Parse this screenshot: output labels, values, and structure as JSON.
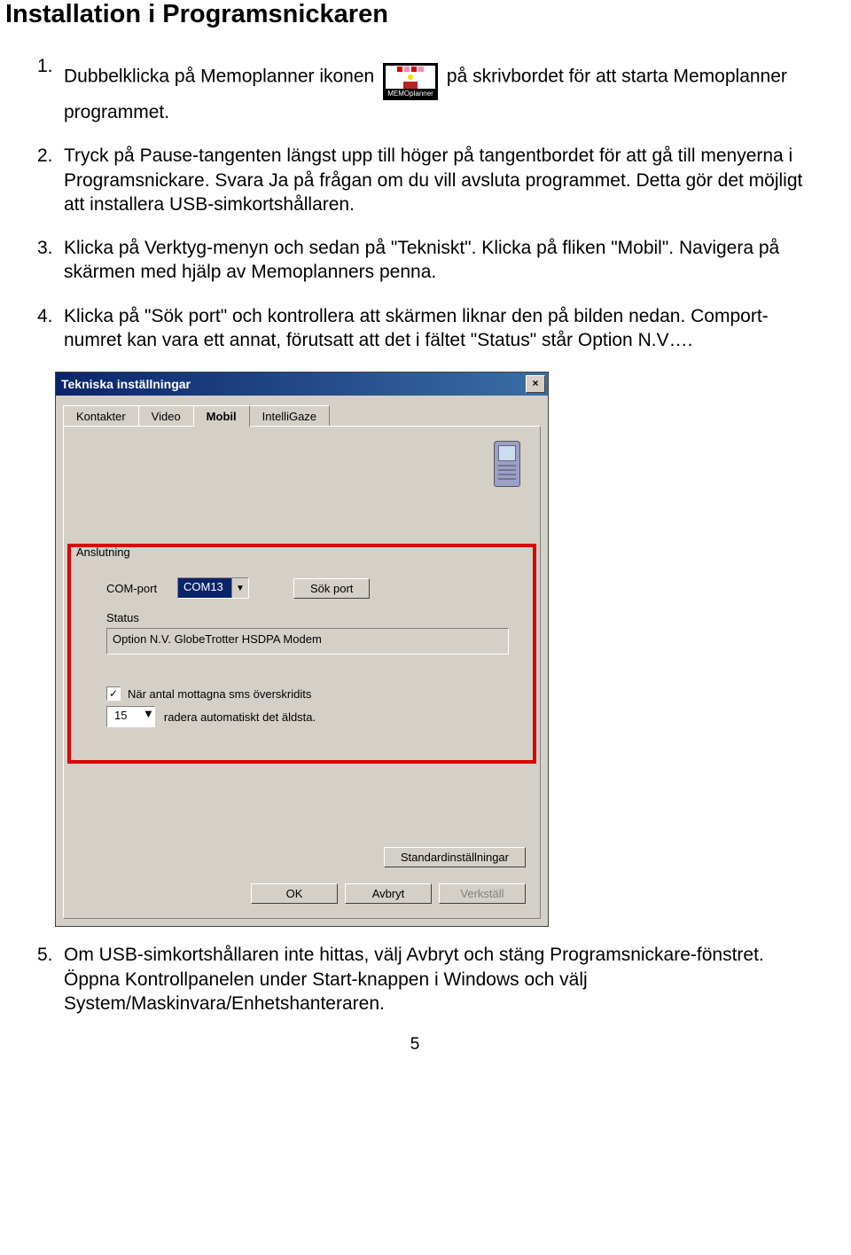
{
  "title": "Installation i Programsnickaren",
  "items": {
    "i1": {
      "num": "1.",
      "t1": "Dubbelklicka på Memoplanner ikonen",
      "t2": "på skrivbordet för att starta Memoplanner programmet."
    },
    "i2": {
      "num": "2.",
      "text": "Tryck på Pause-tangenten längst upp till höger på tangentbordet för att gå till menyerna i Programsnickare. Svara Ja på frågan om du vill avsluta programmet. Detta gör det möjligt att installera USB-simkortshållaren."
    },
    "i3": {
      "num": "3.",
      "text": "Klicka på Verktyg-menyn och sedan på \"Tekniskt\". Klicka på fliken \"Mobil\". Navigera på skärmen med hjälp av Memoplanners penna."
    },
    "i4": {
      "num": "4.",
      "text": "Klicka på \"Sök port\" och kontrollera att skärmen liknar den på bilden nedan. Comport-numret kan vara ett annat, förutsatt att det i fältet \"Status\" står Option N.V…."
    },
    "i5": {
      "num": "5.",
      "text": "Om USB-simkortshållaren inte hittas, välj Avbryt och stäng Programsnickare-fönstret. Öppna Kontrollpanelen under Start-knappen i Windows och välj System/Maskinvara/Enhetshanteraren."
    }
  },
  "icon_caption": "MEMOplanner",
  "dialog": {
    "title": "Tekniska inställningar",
    "close": "×",
    "tabs": {
      "t1": "Kontakter",
      "t2": "Video",
      "t3": "Mobil",
      "t4": "IntelliGaze"
    },
    "group": "Anslutning",
    "comport_label": "COM-port",
    "comport_value": "COM13",
    "sokport": "Sök port",
    "status_label": "Status",
    "status_value": "Option N.V. GlobeTrotter HSDPA Modem",
    "check_label": "När antal mottagna sms överskridits",
    "spin_value": "15",
    "spin_label": "radera automatiskt det äldsta.",
    "std_btn": "Standardinställningar",
    "ok": "OK",
    "avbryt": "Avbryt",
    "verkstall": "Verkställ"
  },
  "page_number": "5"
}
